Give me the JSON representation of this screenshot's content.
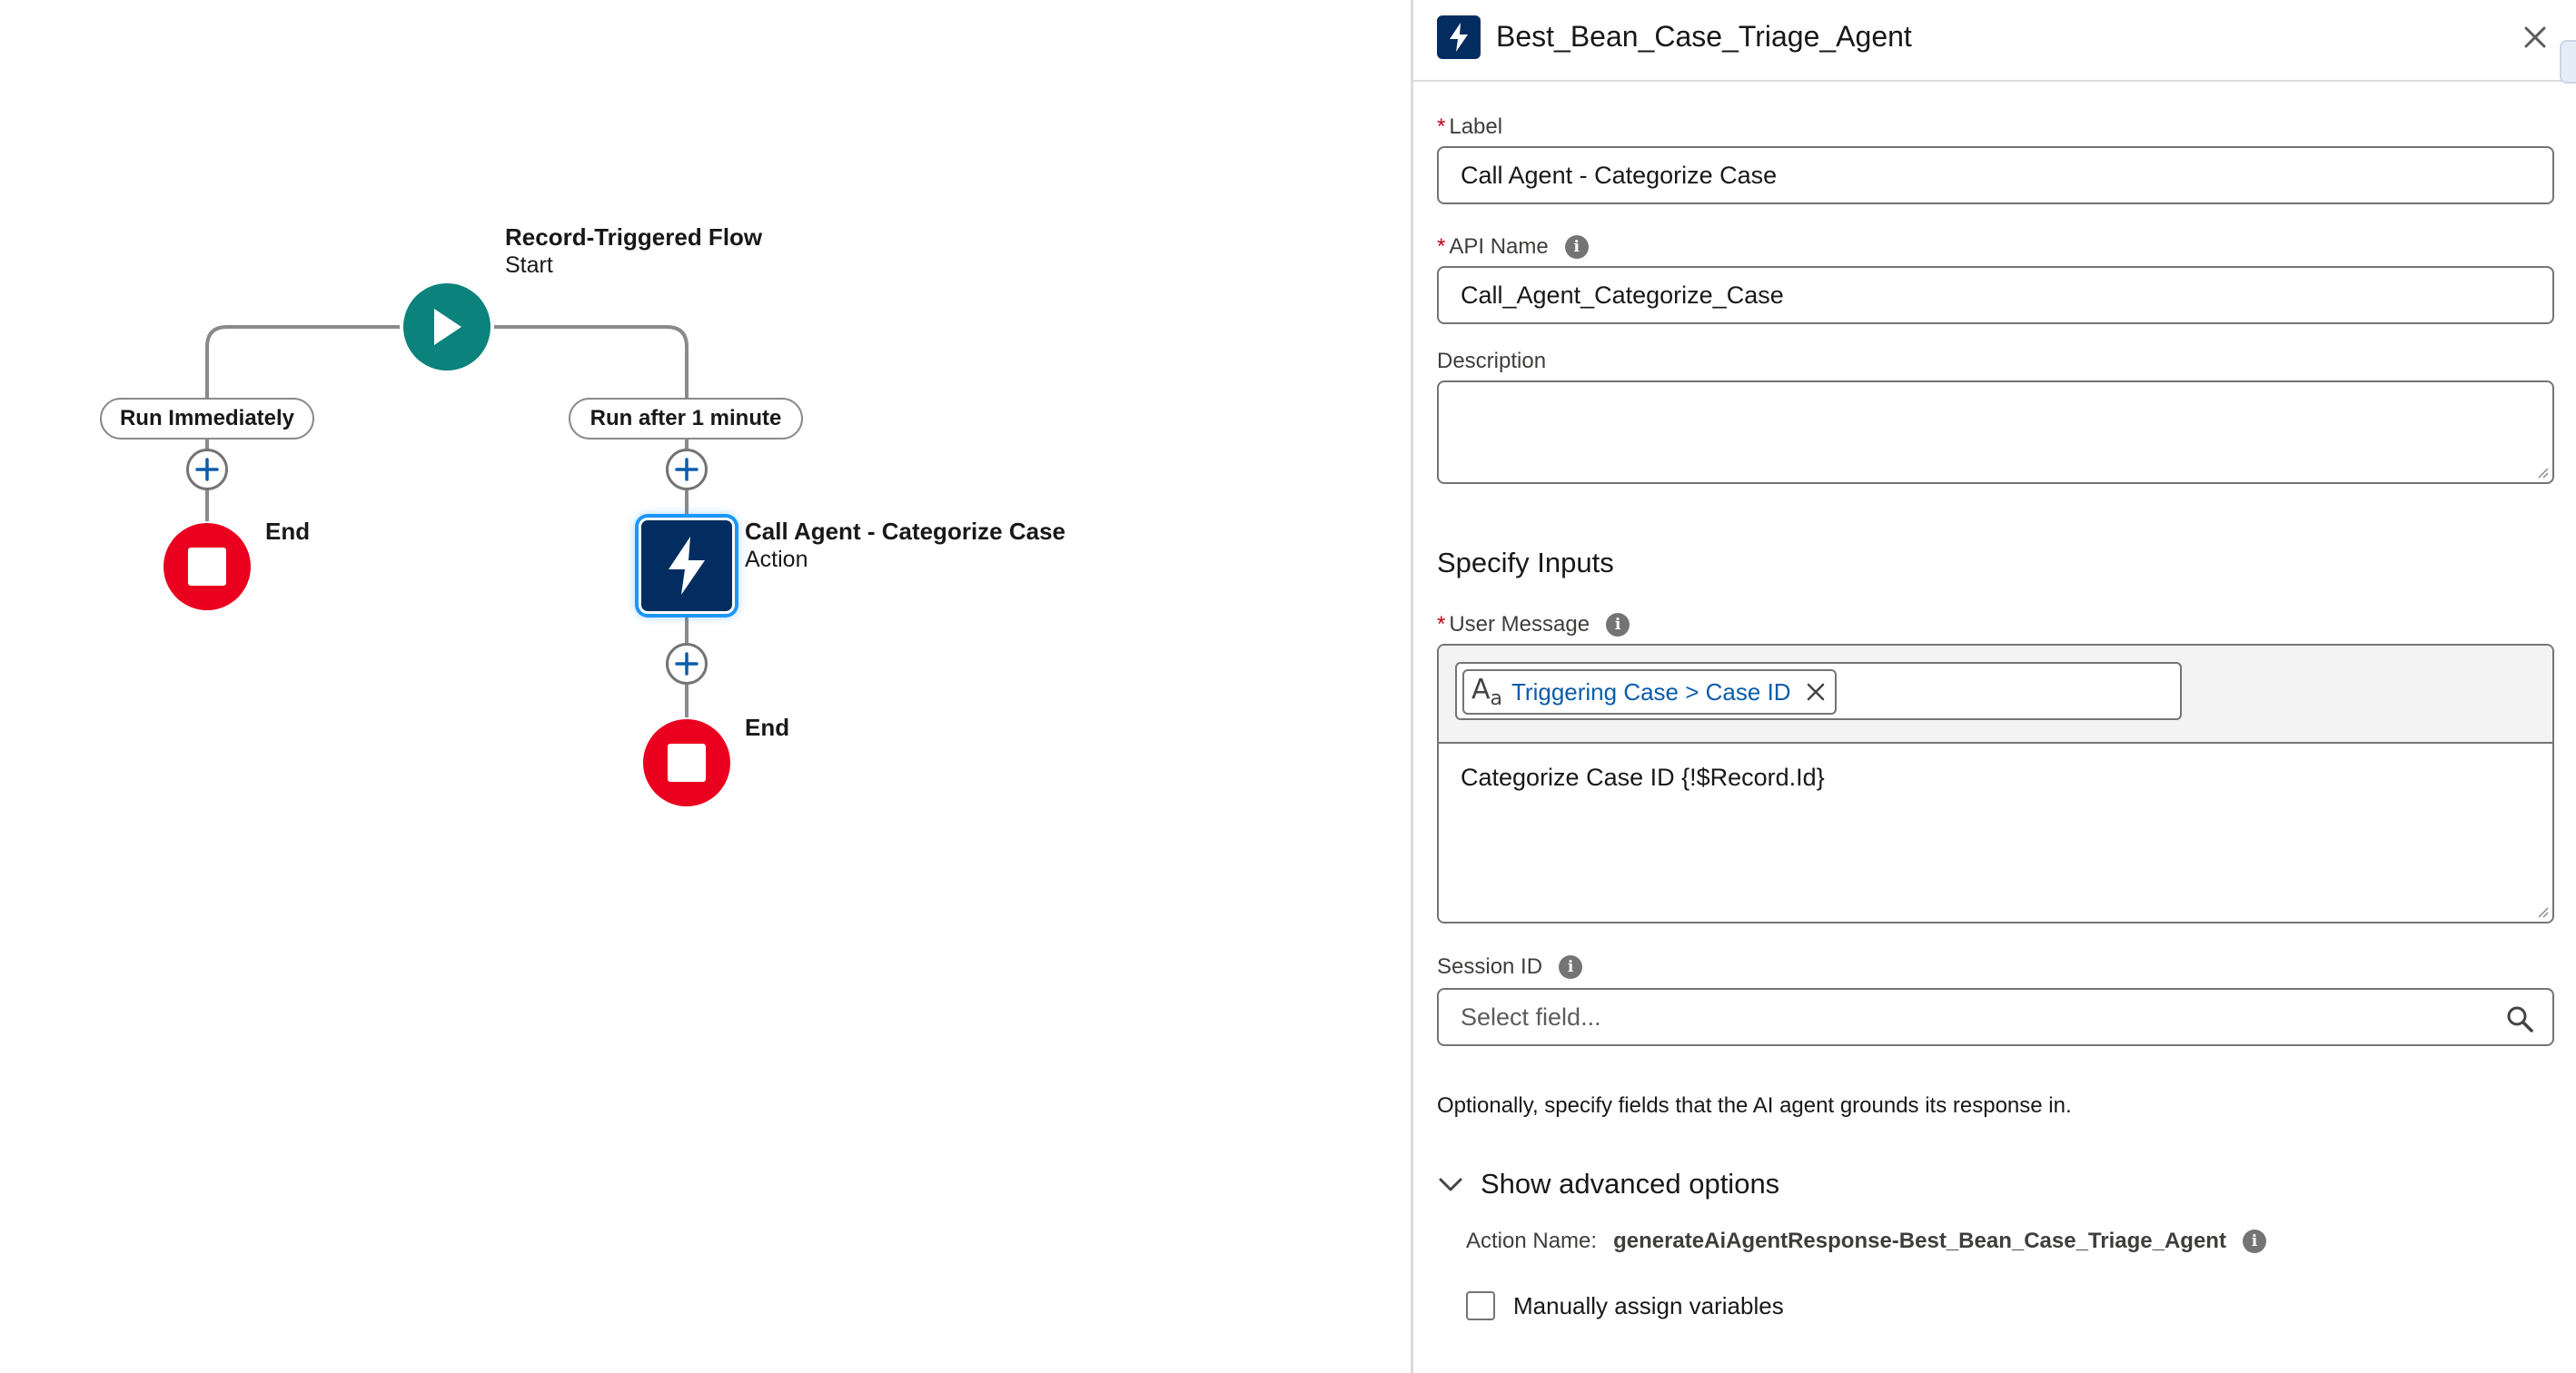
{
  "flow": {
    "start": {
      "title": "Record-Triggered Flow",
      "subtitle": "Start"
    },
    "paths": [
      {
        "label": "Run Immediately",
        "end_label": "End"
      },
      {
        "label": "Run after 1 minute",
        "action_title": "Call Agent - Categorize Case",
        "action_subtitle": "Action",
        "end_label": "End"
      }
    ],
    "colors": {
      "start": "#0b827c",
      "end": "#ea001e",
      "action": "#032d60",
      "selection": "#1b96ff"
    }
  },
  "panel": {
    "title": "Best_Bean_Case_Triage_Agent",
    "icon": "lightning-bolt-icon",
    "label_field": {
      "label": "Label",
      "value": "Call Agent - Categorize Case"
    },
    "api_name_field": {
      "label": "API Name",
      "value": "Call_Agent_Categorize_Case"
    },
    "description_field": {
      "label": "Description",
      "value": ""
    },
    "inputs_section_title": "Specify Inputs",
    "user_message": {
      "label": "User Message",
      "token": "Triggering Case > Case ID",
      "body": "Categorize Case ID {!$Record.Id}"
    },
    "session_id": {
      "label": "Session ID",
      "placeholder": "Select field..."
    },
    "help_text": "Optionally, specify fields that the AI agent grounds its response in.",
    "advanced_toggle": "Show advanced options",
    "action_name": {
      "label": "Action Name:",
      "value": "generateAiAgentResponse-Best_Bean_Case_Triage_Agent"
    },
    "manual_assign": {
      "label": "Manually assign variables",
      "checked": false
    }
  }
}
